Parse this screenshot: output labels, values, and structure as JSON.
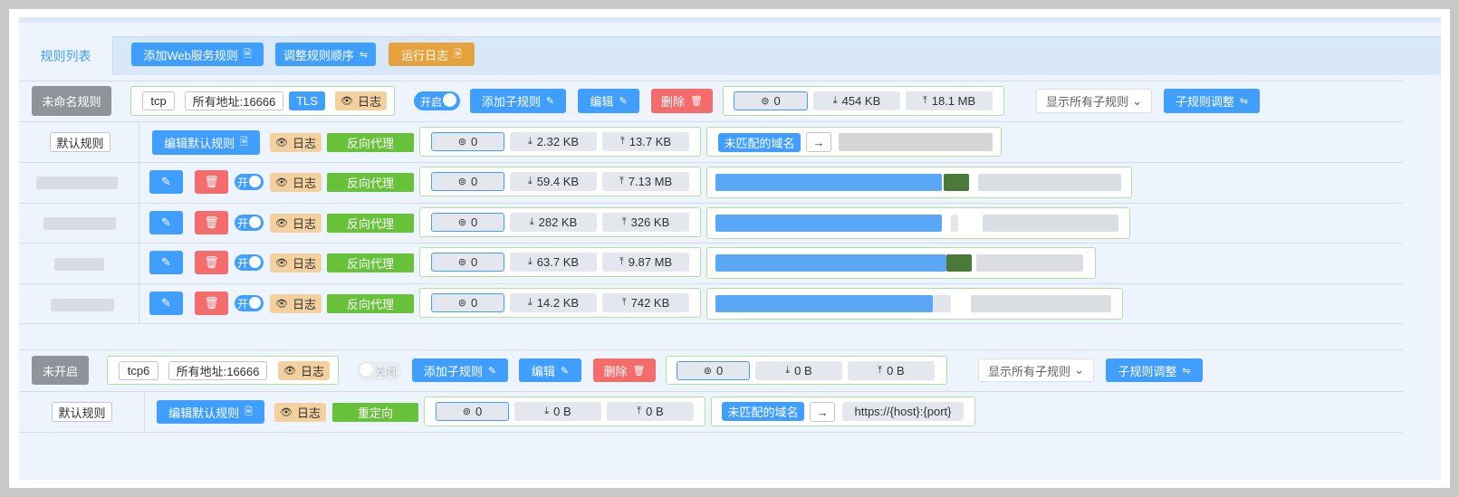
{
  "tabs": {
    "active": "规则列表",
    "add_web": "添加Web服务规则",
    "reorder": "调整规则顺序",
    "logs": "运行日志"
  },
  "common": {
    "log": "日志",
    "edit_default": "编辑默认规则",
    "add_sub": "添加子规则",
    "edit": "编辑",
    "delete": "删除",
    "show_all": "显示所有子规则",
    "sub_adjust": "子规则调整",
    "unmatched": "未匹配的域名",
    "default_rule": "默认规则",
    "on_short": "开",
    "on": "开启",
    "off": "关闭",
    "reverse_proxy": "反向代理",
    "redirect": "重定向"
  },
  "rule1": {
    "name": "未命名规则",
    "protocol": "tcp",
    "listen": "所有地址:16666",
    "tls": "TLS",
    "stats": {
      "conn": "0",
      "down": "454 KB",
      "up": "18.1 MB"
    },
    "default": {
      "stats": {
        "conn": "0",
        "down": "2.32 KB",
        "up": "13.7 KB"
      }
    },
    "subrules": [
      {
        "conn": "0",
        "down": "59.4 KB",
        "up": "7.13 MB"
      },
      {
        "conn": "0",
        "down": "282 KB",
        "up": "326 KB"
      },
      {
        "conn": "0",
        "down": "63.7 KB",
        "up": "9.87 MB"
      },
      {
        "conn": "0",
        "down": "14.2 KB",
        "up": "742 KB"
      }
    ]
  },
  "rule2": {
    "name": "未开启",
    "protocol": "tcp6",
    "listen": "所有地址:16666",
    "stats": {
      "conn": "0",
      "down": "0 B",
      "up": "0 B"
    },
    "default": {
      "stats": {
        "conn": "0",
        "down": "0 B",
        "up": "0 B"
      },
      "target": "https://{host}:{port}"
    }
  },
  "colors": {
    "primary": "#409eff",
    "success": "#67c23a",
    "danger": "#f56c6c",
    "warning": "#e6a23c",
    "info": "#909399"
  },
  "icons": [
    "file-icon",
    "swap-icon",
    "edit-icon",
    "trash-icon",
    "eye-icon",
    "link-icon",
    "download-icon",
    "upload-icon",
    "chevron-down-icon",
    "arrow-right-icon"
  ]
}
